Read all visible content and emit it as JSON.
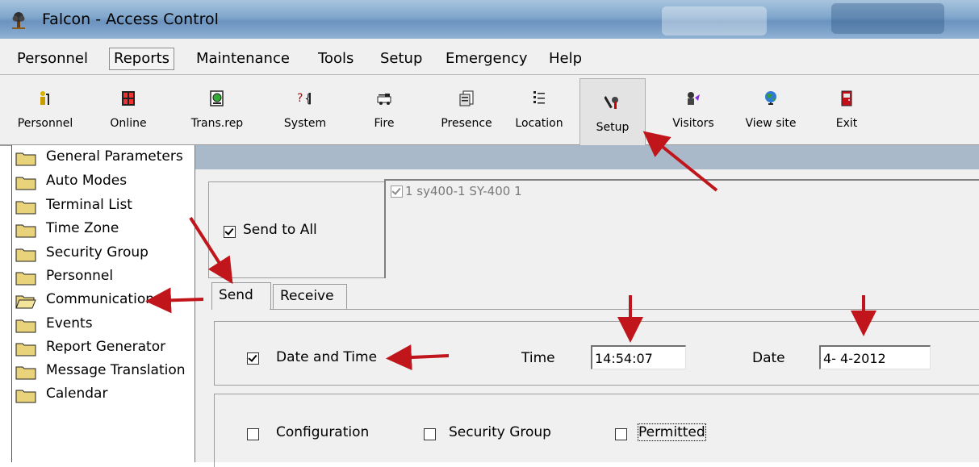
{
  "window": {
    "title": "Falcon - Access Control",
    "app_icon": "falcon-tree-icon"
  },
  "menu": [
    "Personnel",
    "Reports",
    "Maintenance",
    "Tools",
    "Setup",
    "Emergency",
    "Help"
  ],
  "toolbar": [
    {
      "label": "Personnel",
      "icon": "personnel-icon"
    },
    {
      "label": "Online",
      "icon": "online-icon"
    },
    {
      "label": "Trans.rep",
      "icon": "trans-rep-icon"
    },
    {
      "label": "System",
      "icon": "system-icon"
    },
    {
      "label": "Fire",
      "icon": "fire-truck-icon"
    },
    {
      "label": "Presence",
      "icon": "presence-icon"
    },
    {
      "label": "Location",
      "icon": "location-icon"
    },
    {
      "label": "Setup",
      "icon": "setup-icon",
      "active": true
    },
    {
      "label": "Visitors",
      "icon": "visitors-icon"
    },
    {
      "label": "View site",
      "icon": "globe-icon"
    },
    {
      "label": "Exit",
      "icon": "exit-door-icon"
    }
  ],
  "tree": [
    {
      "label": "General Parameters"
    },
    {
      "label": "Auto Modes"
    },
    {
      "label": "Terminal List"
    },
    {
      "label": "Time Zone"
    },
    {
      "label": "Security Group"
    },
    {
      "label": "Personnel"
    },
    {
      "label": "Communication",
      "selected": true
    },
    {
      "label": "Events"
    },
    {
      "label": "Report Generator"
    },
    {
      "label": "Message Translation"
    },
    {
      "label": "Calendar"
    }
  ],
  "send_to_all": {
    "label": "Send to All",
    "checked": true
  },
  "terminal": {
    "label": "1 sy400-1  SY-400  1",
    "checked": true
  },
  "tabs": {
    "send": "Send",
    "receive": "Receive",
    "active": "Send"
  },
  "date_time": {
    "label": "Date and Time",
    "checked": true,
    "time_label": "Time",
    "time_value": "14:54:07",
    "date_label": "Date",
    "date_value": "4- 4-2012"
  },
  "options": [
    {
      "label": "Configuration",
      "checked": false
    },
    {
      "label": "Security Group",
      "checked": false
    },
    {
      "label": "Permitted",
      "checked": false
    }
  ],
  "colors": {
    "annotation_arrow": "#c0151b",
    "folder": "#e8d37a"
  }
}
